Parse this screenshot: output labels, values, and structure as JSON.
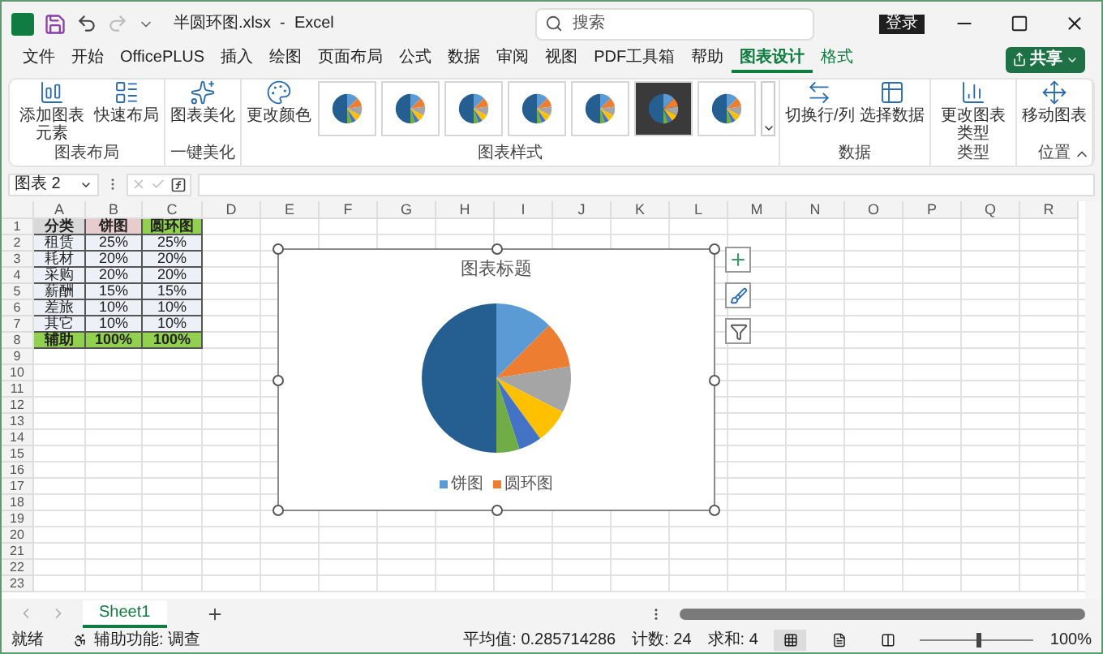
{
  "window": {
    "title": "半圆环图.xlsx  -  Excel",
    "search": {
      "placeholder": "搜索"
    },
    "login": "登录"
  },
  "menu": [
    {
      "label": "文件",
      "selected": false,
      "kind": "tab"
    },
    {
      "label": "开始",
      "selected": false,
      "kind": "tab"
    },
    {
      "label": "OfficePLUS",
      "selected": false,
      "kind": "tab"
    },
    {
      "label": "插入",
      "selected": false,
      "kind": "tab"
    },
    {
      "label": "绘图",
      "selected": false,
      "kind": "tab"
    },
    {
      "label": "页面布局",
      "selected": false,
      "kind": "tab"
    },
    {
      "label": "公式",
      "selected": false,
      "kind": "tab"
    },
    {
      "label": "数据",
      "selected": false,
      "kind": "tab"
    },
    {
      "label": "审阅",
      "selected": false,
      "kind": "tab"
    },
    {
      "label": "视图",
      "selected": false,
      "kind": "tab"
    },
    {
      "label": "PDF工具箱",
      "selected": false,
      "kind": "tab"
    },
    {
      "label": "帮助",
      "selected": false,
      "kind": "tab"
    },
    {
      "label": "图表设计",
      "selected": true,
      "kind": "context"
    },
    {
      "label": "格式",
      "selected": false,
      "kind": "context"
    }
  ],
  "share": "共享",
  "ribbon": [
    {
      "label": "图表布局",
      "buttons": [
        {
          "label": "添加图表元素",
          "kind": "add-element"
        },
        {
          "label": "快速布局",
          "kind": "layout"
        }
      ]
    },
    {
      "label": "一键美化",
      "buttons": [
        {
          "label": "图表美化",
          "kind": "beautify"
        }
      ]
    },
    {
      "label": "图表样式",
      "buttons": [
        {
          "label": "更改颜色",
          "kind": "palette"
        }
      ],
      "styles": [
        {
          "dark": false
        },
        {
          "dark": false
        },
        {
          "dark": false
        },
        {
          "dark": false
        },
        {
          "dark": false
        },
        {
          "dark": true
        },
        {
          "dark": false
        }
      ]
    },
    {
      "label": "数据",
      "buttons": [
        {
          "label": "切换行/列",
          "kind": "switch"
        },
        {
          "label": "选择数据",
          "kind": "select-data"
        }
      ]
    },
    {
      "label": "类型",
      "buttons": [
        {
          "label": "更改图表类型",
          "kind": "chart-type"
        }
      ]
    },
    {
      "label": "位置",
      "buttons": [
        {
          "label": "移动图表",
          "kind": "move"
        }
      ]
    }
  ],
  "name_box": "图表 2",
  "columns": [
    "A",
    "B",
    "C",
    "D",
    "E",
    "F",
    "G",
    "H",
    "I",
    "J",
    "K",
    "L",
    "M",
    "N",
    "O",
    "P",
    "Q",
    "R"
  ],
  "rows": [
    "1",
    "2",
    "3",
    "4",
    "5",
    "6",
    "7",
    "8",
    "9",
    "10",
    "11",
    "12",
    "13",
    "14",
    "15",
    "16",
    "17",
    "18",
    "19",
    "20",
    "21",
    "22",
    "23"
  ],
  "table": [
    {
      "kind": "header",
      "cells": [
        "分类",
        "饼图",
        "圆环图"
      ]
    },
    {
      "kind": "data",
      "cells": [
        "租赁",
        "25%",
        "25%"
      ]
    },
    {
      "kind": "data",
      "cells": [
        "耗材",
        "20%",
        "20%"
      ]
    },
    {
      "kind": "data",
      "cells": [
        "采购",
        "20%",
        "20%"
      ]
    },
    {
      "kind": "data",
      "cells": [
        "薪酬",
        "15%",
        "15%"
      ]
    },
    {
      "kind": "data",
      "cells": [
        "差旅",
        "10%",
        "10%"
      ]
    },
    {
      "kind": "data",
      "cells": [
        "其它",
        "10%",
        "10%"
      ]
    },
    {
      "kind": "total",
      "cells": [
        "辅助",
        "100%",
        "100%"
      ]
    }
  ],
  "chart": {
    "title": "图表标题",
    "legend": [
      {
        "label": "饼图",
        "color": "#5b9bd5"
      },
      {
        "label": "圆环图",
        "color": "#ed7d31"
      }
    ]
  },
  "sheets": [
    {
      "label": "Sheet1",
      "selected": true
    }
  ],
  "status": {
    "ready": "就绪",
    "accessibility": "辅助功能: 调查",
    "average": "平均值: 0.285714286",
    "count": "计数: 24",
    "sum": "求和: 4",
    "views": [
      {
        "kind": "normal",
        "selected": true
      },
      {
        "kind": "page-layout",
        "selected": false
      },
      {
        "kind": "page-break",
        "selected": false
      }
    ],
    "zoom": {
      "level": 0.5,
      "reading": "100%"
    }
  }
}
